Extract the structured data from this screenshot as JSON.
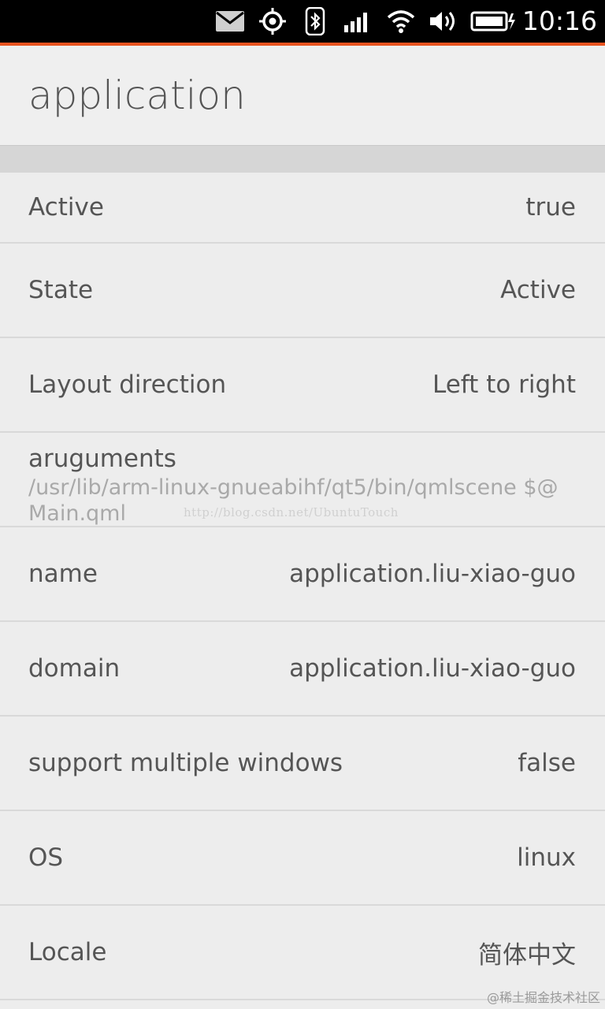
{
  "status_bar": {
    "time": "10:16",
    "icons": [
      "mail-icon",
      "location-icon",
      "bluetooth-icon",
      "signal-icon",
      "wifi-icon",
      "volume-icon",
      "battery-icon"
    ],
    "background": "#000000",
    "accent_color": "#e95420"
  },
  "header": {
    "title": "application"
  },
  "rows": [
    {
      "label": "Active",
      "value": "true"
    },
    {
      "label": "State",
      "value": "Active"
    },
    {
      "label": "Layout direction",
      "value": "Left to right"
    },
    {
      "label": "aruguments",
      "subtitle": "/usr/lib/arm-linux-gnueabihf/qt5/bin/qmlscene $@ Main.qml"
    },
    {
      "label": "name",
      "value": "application.liu-xiao-guo"
    },
    {
      "label": "domain",
      "value": "application.liu-xiao-guo"
    },
    {
      "label": "support multiple windows",
      "value": "false"
    },
    {
      "label": "OS",
      "value": "linux"
    },
    {
      "label": "Locale",
      "value": "简体中文"
    }
  ],
  "watermark": "http://blog.csdn.net/UbuntuTouch",
  "corner_mark": "@稀土掘金技术社区"
}
